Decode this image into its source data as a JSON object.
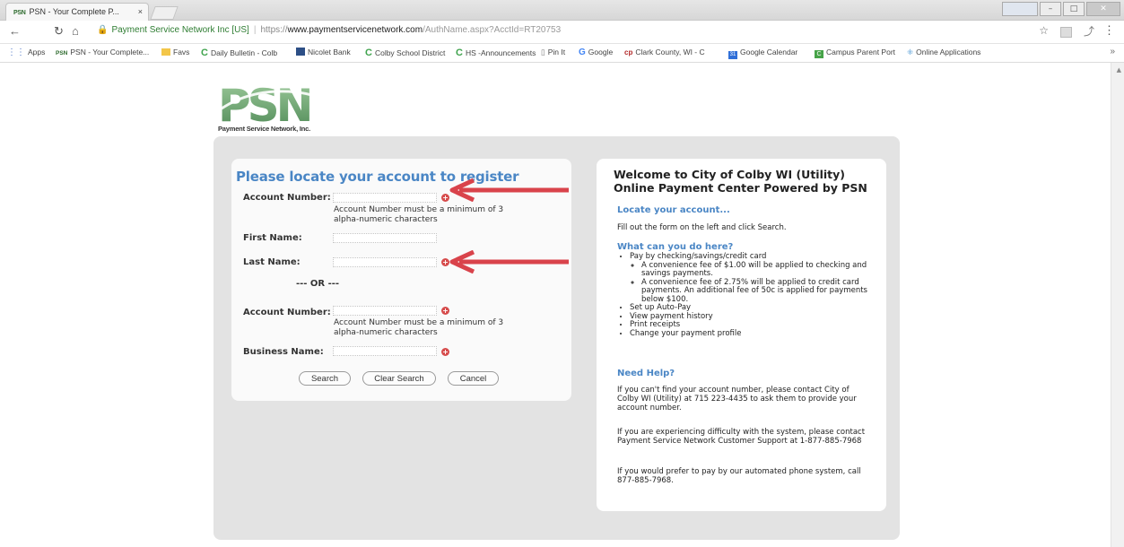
{
  "browser": {
    "tab_title": "PSN - Your Complete P...",
    "tab_close": "×",
    "user_button": "[user]",
    "url_secure_label": "Payment Service Network Inc [US]",
    "url_scheme": "https://",
    "url_host": "www.paymentservicenetwork.com",
    "url_path": "/AuthName.aspx?AcctId=RT20753",
    "bookmarks": [
      {
        "label": "Apps",
        "icon": "apps-icon"
      },
      {
        "label": "PSN - Your Complete...",
        "icon": "psn-icon"
      },
      {
        "label": "Favs",
        "icon": "folder-icon"
      },
      {
        "label": "Daily Bulletin - Colb",
        "icon": "c-icon"
      },
      {
        "label": "Nicolet Bank",
        "icon": "bank-icon"
      },
      {
        "label": "Colby School District",
        "icon": "c-icon"
      },
      {
        "label": "HS -Announcements",
        "icon": "c-icon"
      },
      {
        "label": "Pin It",
        "icon": "page-icon"
      },
      {
        "label": "Google",
        "icon": "google-icon"
      },
      {
        "label": "Clark County, WI - C",
        "icon": "clark-icon"
      },
      {
        "label": "Google Calendar",
        "icon": "calendar-icon"
      },
      {
        "label": "Campus Parent Port",
        "icon": "campus-icon"
      },
      {
        "label": "Online Applications",
        "icon": "app-icon"
      }
    ],
    "bookmarks_more": "»"
  },
  "logo": {
    "letters": "PSN",
    "subtitle": "Payment Service Network, Inc."
  },
  "form": {
    "title": "Please locate your account to register",
    "account_number_label": "Account Number:",
    "account_hint_line1": "Account Number must be a minimum of 3",
    "account_hint_line2": "alpha-numeric characters",
    "first_name_label": "First Name:",
    "last_name_label": "Last Name:",
    "or_text": "--- OR ---",
    "account_number2_label": "Account Number:",
    "business_name_label": "Business Name:",
    "search_button": "Search",
    "clear_button": "Clear Search",
    "cancel_button": "Cancel"
  },
  "info": {
    "title_line1": "Welcome to City of Colby WI (Utility)",
    "title_line2": "Online Payment Center Powered by PSN",
    "locate_heading": "Locate your account...",
    "locate_text": "Fill out the form on the left and click Search.",
    "what_heading": "What can you do here?",
    "pay_item": "Pay by checking/savings/credit card",
    "fee1": "A convenience fee of $1.00 will be applied to checking and savings payments.",
    "fee2": "A convenience fee of 2.75% will be applied to credit card payments. An additional fee of 50c is applied for payments below $100.",
    "actions": [
      "Set up Auto-Pay",
      "View payment history",
      "Print receipts",
      "Change your payment profile"
    ],
    "help_heading": "Need Help?",
    "help_p1": "If you can't find your account number, please contact City of Colby WI (Utility) at 715 223-4435 to ask them to provide your account number.",
    "help_p2": "If you are experiencing difficulty with the system, please contact Payment Service Network Customer Support at 1-877-885-7968",
    "help_p3": "If you would prefer to pay by our automated phone system, call 877-885-7968."
  },
  "colors": {
    "accent": "#4a86c5",
    "required": "#d64b4b",
    "annotation_arrow": "#d9434b",
    "panel_bg": "#e3e3e3"
  }
}
